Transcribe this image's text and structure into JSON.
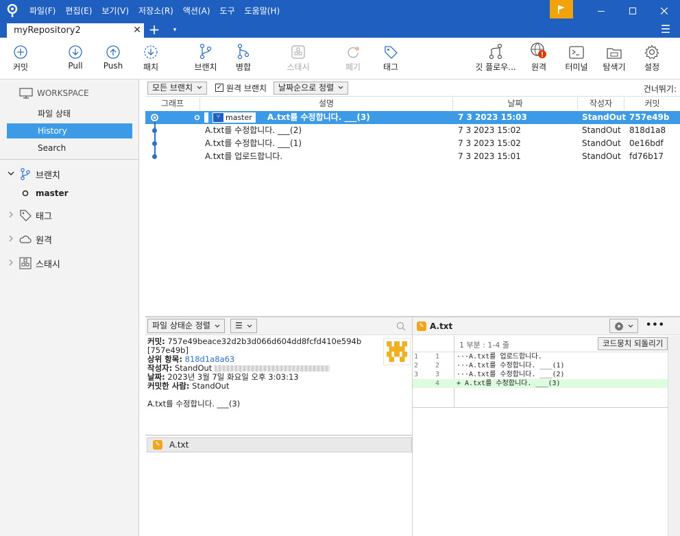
{
  "menu": [
    "파일(F)",
    "편집(E)",
    "보기(V)",
    "저장소(R)",
    "액션(A)",
    "도구",
    "도움말(H)"
  ],
  "tab": {
    "title": "myRepository2",
    "close": "✕",
    "add": "+",
    "dropdown": "▾",
    "menu": "☰"
  },
  "toolbar": {
    "commit": "커밋",
    "pull": "Pull",
    "push": "Push",
    "fetch": "패치",
    "branch": "브랜치",
    "merge": "병합",
    "stash": "스태시",
    "discard": "폐기",
    "tag": "태그",
    "gitflow": "깃 플로우...",
    "remote": "원격",
    "terminal": "터미널",
    "explorer": "탐색기",
    "settings": "설정"
  },
  "sidebar": {
    "workspace": "WORKSPACE",
    "items": [
      "파일 상태",
      "History",
      "Search"
    ],
    "active_index": 1,
    "branches_label": "브랜치",
    "current_branch": "master",
    "tags_label": "태그",
    "remotes_label": "원격",
    "stash_label": "스태시"
  },
  "filter": {
    "all_branches": "모든 브랜치",
    "remote_branches": "원격 브랜치",
    "sort": "날짜순으로 정렬",
    "skip": "건너뛰기:"
  },
  "columns": {
    "graph": "그래프",
    "desc": "설명",
    "date": "날짜",
    "author": "작성자",
    "commit": "커밋"
  },
  "commits": [
    {
      "desc": "A.txt를 수정합니다. ___(3)",
      "date": "7 3 2023 15:03",
      "author": "StandOut",
      "hash": "757e49b",
      "branch": "master"
    },
    {
      "desc": "A.txt를 수정합니다. ___(2)",
      "date": "7 3 2023 15:02",
      "author": "StandOut",
      "hash": "818d1a8"
    },
    {
      "desc": "A.txt를 수정합니다. ___(1)",
      "date": "7 3 2023 15:02",
      "author": "StandOut",
      "hash": "0e16bdf"
    },
    {
      "desc": "A.txt를 업로드합니다.",
      "date": "7 3 2023 15:01",
      "author": "StandOut",
      "hash": "fd76b17"
    }
  ],
  "bottom": {
    "file_sort": "파일 상태순 정렬",
    "list_icon": "☰"
  },
  "commit_info": {
    "commit_label": "커밋:",
    "commit_value": "757e49beace32d2b3d066d604dd8fcfd410e594b",
    "short_hash": "[757e49b]",
    "parent_label": "상위 항목:",
    "parent_value": "818d1a8a63",
    "author_label": "작성자:",
    "author_value": "StandOut",
    "date_label": "날짜:",
    "date_value": "2023년 3월 7일 화요일 오후 3:03:13",
    "committer_label": "커밋한 사람:",
    "committer_value": "StandOut",
    "message": "A.txt를 수정합니다. ___(3)"
  },
  "changed_file": "A.txt",
  "diff": {
    "file": "A.txt",
    "hunk": "1 부분 : 1-4 줄",
    "revert": "코드뭉치 되돌리기",
    "more": "•••",
    "lines": [
      {
        "old": "1",
        "new": "1",
        "text": "···A.txt를 업로드합니다.",
        "type": "ctx"
      },
      {
        "old": "2",
        "new": "2",
        "text": "···A.txt를 수정합니다. ___(1)",
        "type": "ctx"
      },
      {
        "old": "3",
        "new": "3",
        "text": "···A.txt를 수정합니다. ___(2)",
        "type": "ctx"
      },
      {
        "old": "",
        "new": "4",
        "text": "+ A.txt를 수정합니다. ___(3)",
        "type": "add"
      }
    ]
  },
  "colors": {
    "accent": "#1f5fbf",
    "selection": "#3d9ae6",
    "flag": "#f0a30a",
    "added": "#ddfbdd"
  }
}
